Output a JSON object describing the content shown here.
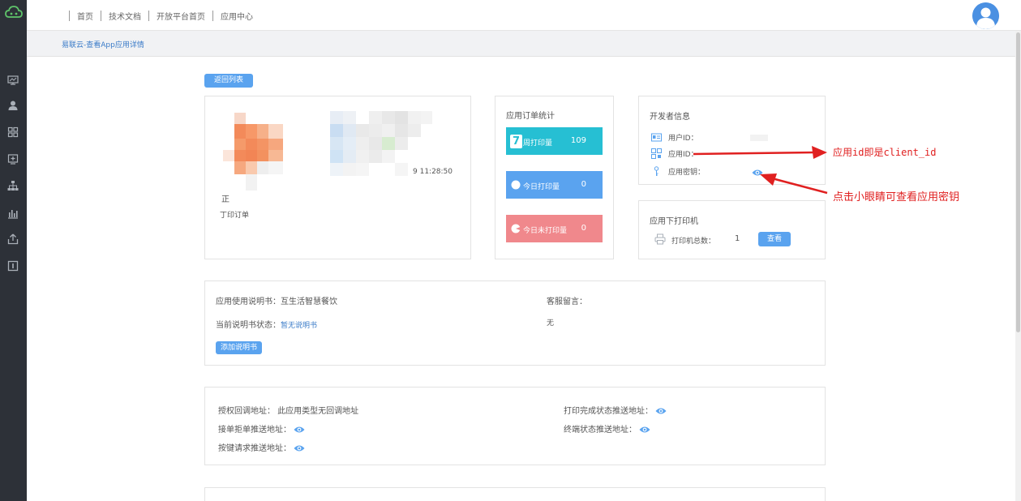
{
  "topbar": {
    "nav": [
      "首页",
      "技术文档",
      "开放平台首页",
      "应用中心"
    ]
  },
  "breadcrumb": "易联云-查看App应用详情",
  "back_button": "返回列表",
  "app_info": {
    "time_fragment": "9 11:28:50",
    "name_fragment": "正",
    "desc_fragment": "丁印订单"
  },
  "order_stats": {
    "title": "应用订单统计",
    "items": [
      {
        "label": "周打印量",
        "value": "109",
        "color": "#26bfd3",
        "icon": "calendar-7-icon"
      },
      {
        "label": "今日打印量",
        "value": "0",
        "color": "#5aa3ef",
        "icon": "circle-icon"
      },
      {
        "label": "今日未打印量",
        "value": "0",
        "color": "#f0888c",
        "icon": "pie-icon"
      }
    ]
  },
  "developer": {
    "title": "开发者信息",
    "user_id_label": "用户ID：",
    "app_id_label": "应用ID：",
    "app_secret_label": "应用密钥："
  },
  "printers": {
    "title": "应用下打印机",
    "total_label": "打印机总数：",
    "total_value": "1",
    "view_button": "查看"
  },
  "manual": {
    "title": "应用使用说明书：互生活智慧餐饮",
    "status_label": "当前说明书状态：",
    "status_value": "暂无说明书",
    "add_button": "添加说明书",
    "service_label": "客服留言：",
    "service_value": "无"
  },
  "callbacks": {
    "auth_label": "授权回调地址：",
    "auth_value": "此应用类型无回调地址",
    "print_done_label": "打印完成状态推送地址：",
    "reject_label": "接单拒单推送地址：",
    "terminal_label": "终端状态推送地址：",
    "key_label": "按键请求推送地址："
  },
  "annotations": {
    "app_id_note": "应用id即是client_id",
    "eye_note": "点击小眼睛可查看应用密钥"
  },
  "colors": {
    "sidebar": "#2d3138",
    "accent": "#5aa3ef",
    "annotation": "#e02020"
  }
}
